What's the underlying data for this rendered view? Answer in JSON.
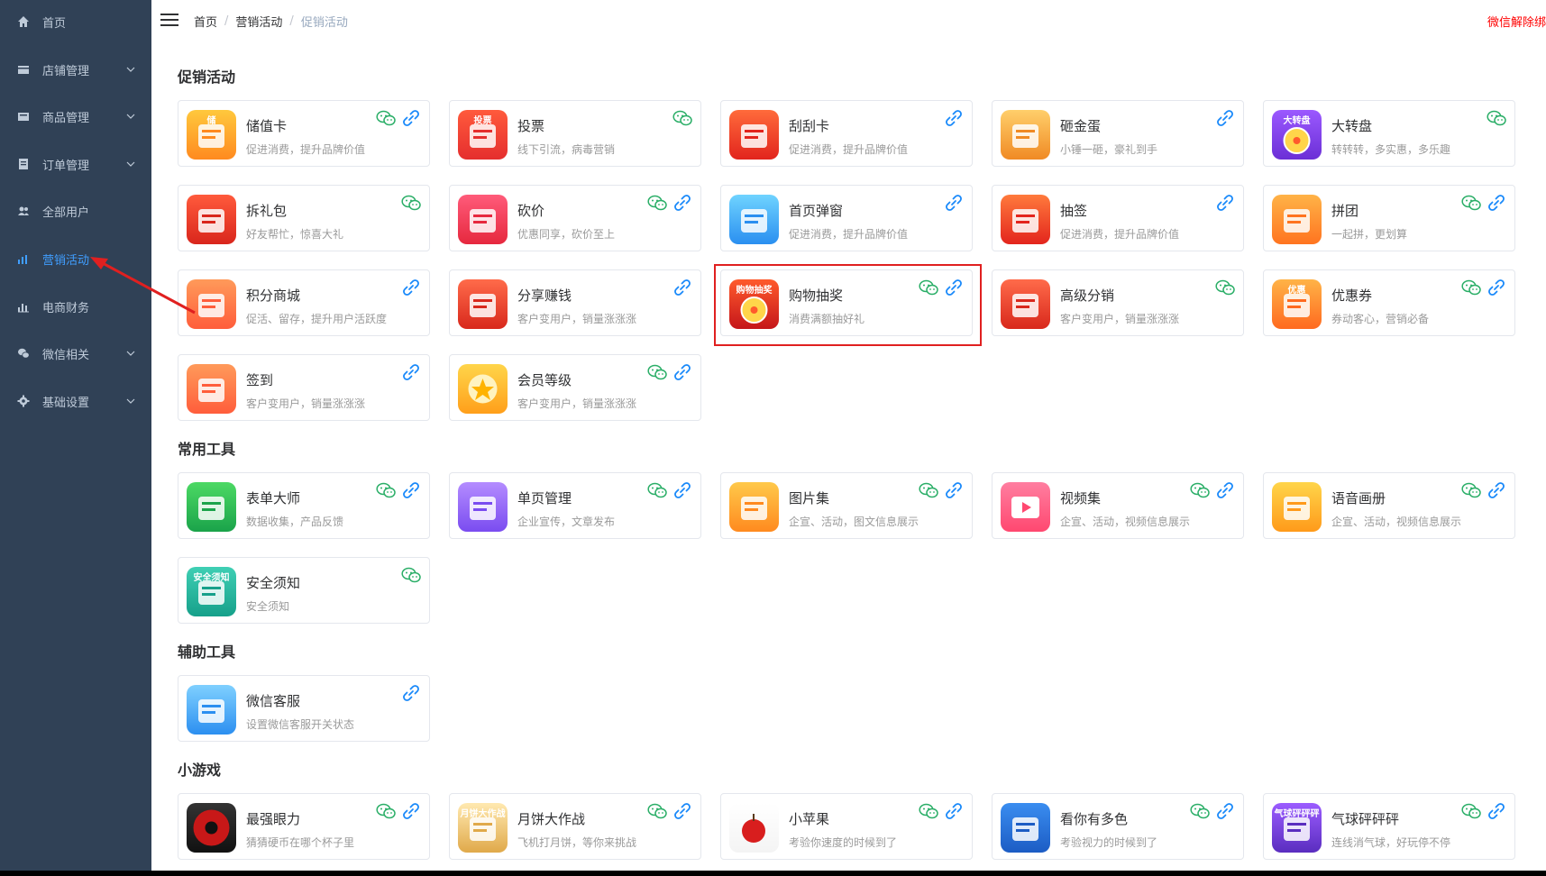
{
  "sidebar": {
    "items": [
      {
        "label": "首页",
        "icon": "home-icon",
        "expandable": false,
        "active": false
      },
      {
        "label": "店铺管理",
        "icon": "store-icon",
        "expandable": true,
        "active": false
      },
      {
        "label": "商品管理",
        "icon": "goods-icon",
        "expandable": true,
        "active": false
      },
      {
        "label": "订单管理",
        "icon": "order-icon",
        "expandable": true,
        "active": false
      },
      {
        "label": "全部用户",
        "icon": "users-icon",
        "expandable": false,
        "active": false
      },
      {
        "label": "营销活动",
        "icon": "chart-icon",
        "expandable": false,
        "active": true
      },
      {
        "label": "电商财务",
        "icon": "finance-icon",
        "expandable": false,
        "active": false
      },
      {
        "label": "微信相关",
        "icon": "wechat-icon",
        "expandable": true,
        "active": false
      },
      {
        "label": "基础设置",
        "icon": "gear-icon",
        "expandable": true,
        "active": false
      }
    ]
  },
  "header": {
    "breadcrumb": [
      "首页",
      "营销活动",
      "促销活动"
    ],
    "unbind_label": "微信解除绑"
  },
  "sections": [
    {
      "title": "促销活动",
      "cards": [
        {
          "title": "储值卡",
          "desc": "促进消费，提升品牌价值",
          "icon": "storage-card-icon",
          "wx": true,
          "link": true,
          "thumb_text": "储"
        },
        {
          "title": "投票",
          "desc": "线下引流，病毒营销",
          "icon": "vote-icon",
          "wx": true,
          "link": false,
          "thumb_text": "投票"
        },
        {
          "title": "刮刮卡",
          "desc": "促进消费，提升品牌价值",
          "icon": "scratch-card-icon",
          "wx": false,
          "link": true,
          "thumb_text": ""
        },
        {
          "title": "砸金蛋",
          "desc": "小锤一砸，豪礼到手",
          "icon": "golden-egg-icon",
          "wx": false,
          "link": true,
          "thumb_text": ""
        },
        {
          "title": "大转盘",
          "desc": "转转转，多实惠，多乐趣",
          "icon": "wheel-icon",
          "wx": true,
          "link": false,
          "thumb_text": "大转盘"
        },
        {
          "title": "拆礼包",
          "desc": "好友帮忙，惊喜大礼",
          "icon": "gift-icon",
          "wx": true,
          "link": false,
          "thumb_text": ""
        },
        {
          "title": "砍价",
          "desc": "优惠同享，砍价至上",
          "icon": "bargain-icon",
          "wx": true,
          "link": true,
          "thumb_text": ""
        },
        {
          "title": "首页弹窗",
          "desc": "促进消费，提升品牌价值",
          "icon": "popup-icon",
          "wx": false,
          "link": true,
          "thumb_text": ""
        },
        {
          "title": "抽签",
          "desc": "促进消费，提升品牌价值",
          "icon": "lottery-stick-icon",
          "wx": false,
          "link": true,
          "thumb_text": ""
        },
        {
          "title": "拼团",
          "desc": "一起拼，更划算",
          "icon": "group-buy-icon",
          "wx": true,
          "link": true,
          "thumb_text": ""
        },
        {
          "title": "积分商城",
          "desc": "促活、留存，提升用户活跃度",
          "icon": "points-mall-icon",
          "wx": false,
          "link": true,
          "thumb_text": ""
        },
        {
          "title": "分享赚钱",
          "desc": "客户变用户，销量涨涨涨",
          "icon": "share-earn-icon",
          "wx": false,
          "link": true,
          "thumb_text": ""
        },
        {
          "title": "购物抽奖",
          "desc": "消费满额抽好礼",
          "icon": "shopping-draw-icon",
          "wx": true,
          "link": true,
          "thumb_text": "购物抽奖"
        },
        {
          "title": "高级分销",
          "desc": "客户变用户，销量涨涨涨",
          "icon": "distribution-icon",
          "wx": true,
          "link": false,
          "thumb_text": ""
        },
        {
          "title": "优惠券",
          "desc": "券动客心，营销必备",
          "icon": "coupon-icon",
          "wx": true,
          "link": true,
          "thumb_text": "优惠"
        },
        {
          "title": "签到",
          "desc": "客户变用户，销量涨涨涨",
          "icon": "checkin-icon",
          "wx": false,
          "link": true,
          "thumb_text": ""
        },
        {
          "title": "会员等级",
          "desc": "客户变用户，销量涨涨涨",
          "icon": "member-level-icon",
          "wx": true,
          "link": true,
          "thumb_text": ""
        }
      ]
    },
    {
      "title": "常用工具",
      "cards": [
        {
          "title": "表单大师",
          "desc": "数据收集，产品反馈",
          "icon": "form-icon",
          "wx": true,
          "link": true,
          "thumb_text": ""
        },
        {
          "title": "单页管理",
          "desc": "企业宣传，文章发布",
          "icon": "single-page-icon",
          "wx": true,
          "link": true,
          "thumb_text": ""
        },
        {
          "title": "图片集",
          "desc": "企宣、活动，图文信息展示",
          "icon": "gallery-icon",
          "wx": true,
          "link": true,
          "thumb_text": ""
        },
        {
          "title": "视频集",
          "desc": "企宣、活动，视频信息展示",
          "icon": "video-icon",
          "wx": true,
          "link": true,
          "thumb_text": ""
        },
        {
          "title": "语音画册",
          "desc": "企宣、活动，视频信息展示",
          "icon": "voice-album-icon",
          "wx": true,
          "link": true,
          "thumb_text": ""
        },
        {
          "title": "安全须知",
          "desc": "安全须知",
          "icon": "safety-icon",
          "wx": true,
          "link": false,
          "thumb_text": "安全须知"
        }
      ]
    },
    {
      "title": "辅助工具",
      "cards": [
        {
          "title": "微信客服",
          "desc": "设置微信客服开关状态",
          "icon": "customer-service-icon",
          "wx": false,
          "link": true,
          "thumb_text": ""
        }
      ]
    },
    {
      "title": "小游戏",
      "cards": [
        {
          "title": "最强眼力",
          "desc": "猜猜硬币在哪个杯子里",
          "icon": "eye-game-icon",
          "wx": true,
          "link": true,
          "thumb_text": ""
        },
        {
          "title": "月饼大作战",
          "desc": "飞机打月饼，等你来挑战",
          "icon": "mooncake-game-icon",
          "wx": true,
          "link": true,
          "thumb_text": "月饼大作战"
        },
        {
          "title": "小苹果",
          "desc": "考验你速度的时候到了",
          "icon": "apple-game-icon",
          "wx": true,
          "link": true,
          "thumb_text": ""
        },
        {
          "title": "看你有多色",
          "desc": "考验视力的时候到了",
          "icon": "color-game-icon",
          "wx": true,
          "link": true,
          "thumb_text": ""
        },
        {
          "title": "气球砰砰砰",
          "desc": "连线消气球，好玩停不停",
          "icon": "balloon-game-icon",
          "wx": true,
          "link": true,
          "thumb_text": "气球砰砰砰"
        }
      ]
    }
  ],
  "colors": {
    "sidebar_bg": "#304156",
    "active": "#409eff",
    "wechat_green": "#2aae67",
    "link_blue": "#1989fa",
    "highlight": "#e02020"
  }
}
